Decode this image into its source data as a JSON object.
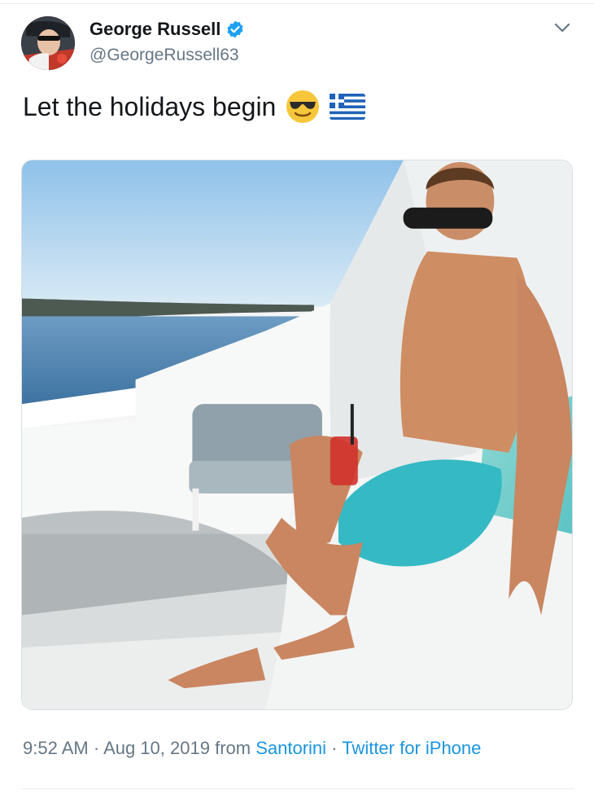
{
  "tweet": {
    "author": {
      "display_name": "George Russell",
      "handle": "@GeorgeRussell63",
      "verified": true
    },
    "text": "Let the holidays begin",
    "emojis": [
      "smiling-face-with-sunglasses",
      "greece-flag"
    ],
    "media": {
      "kind": "photo"
    },
    "meta": {
      "time": "9:52 AM",
      "dot1": " · ",
      "date": "Aug 10, 2019",
      "from_word": " from ",
      "location": "Santorini",
      "dot2": " · ",
      "client": "Twitter for iPhone"
    }
  },
  "colors": {
    "text": "#14171a",
    "secondary": "#657786",
    "link": "#1b95e0",
    "verified": "#1da1f2"
  }
}
